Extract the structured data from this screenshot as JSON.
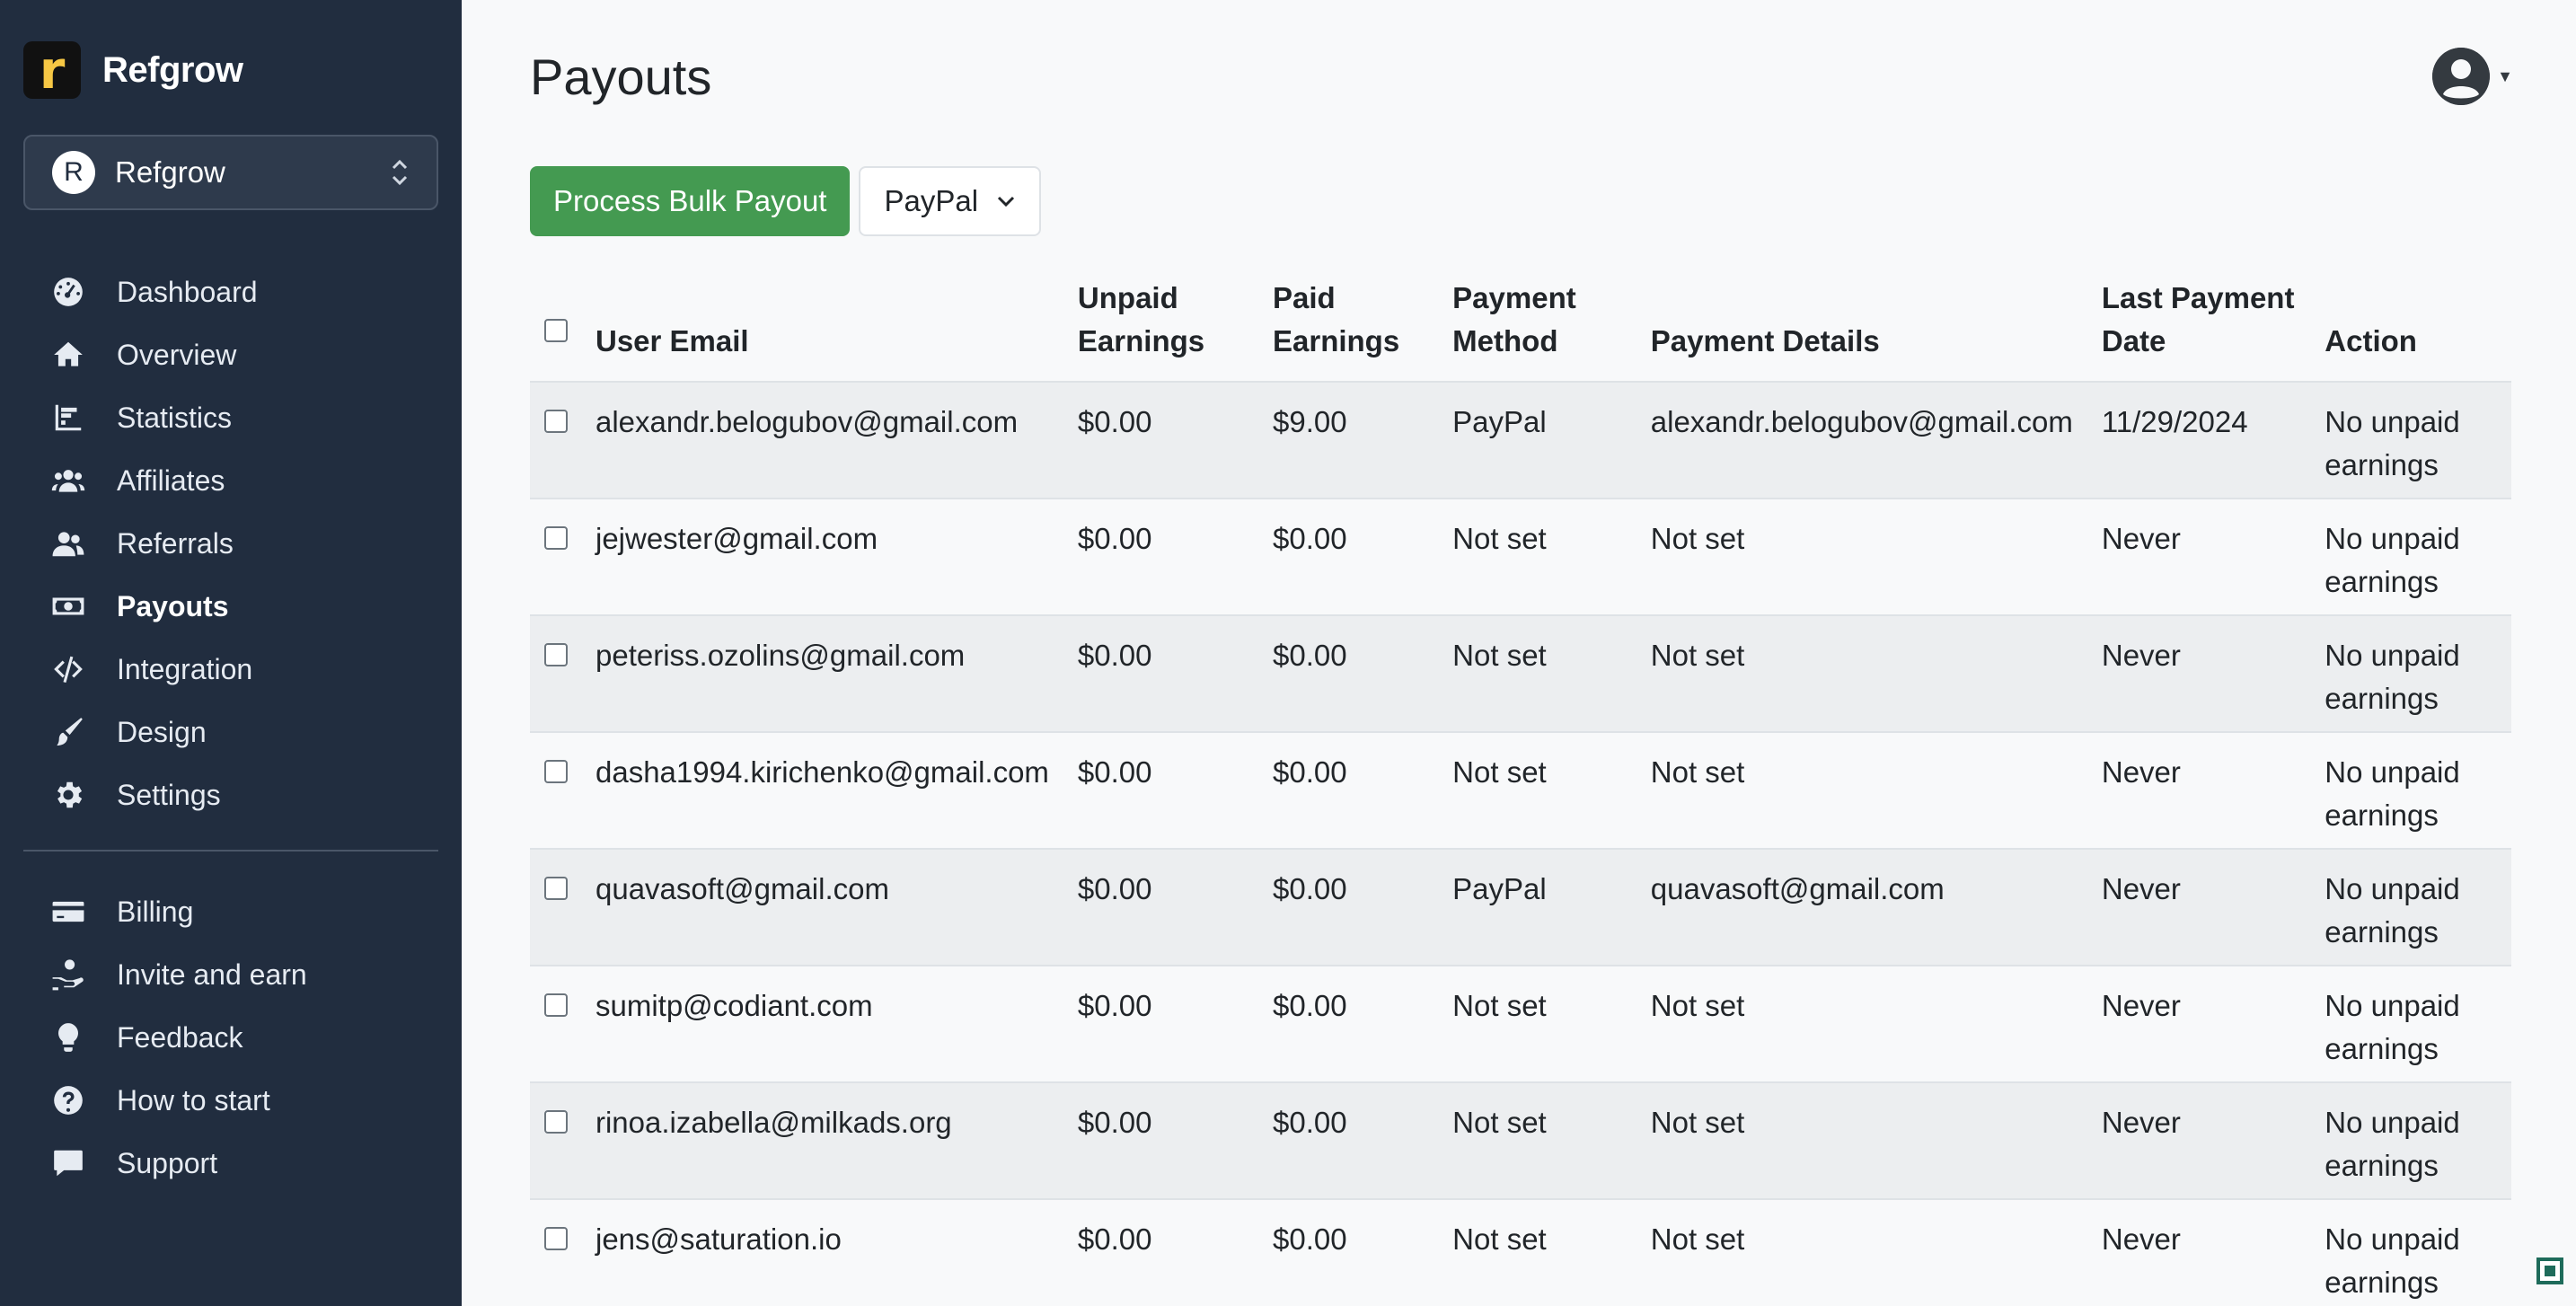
{
  "brand": {
    "logo_letter": "r",
    "name": "Refgrow"
  },
  "org": {
    "initial": "R",
    "name": "Refgrow"
  },
  "nav_primary": [
    {
      "label": "Dashboard",
      "icon": "gauge-icon"
    },
    {
      "label": "Overview",
      "icon": "home-icon"
    },
    {
      "label": "Statistics",
      "icon": "chart-icon"
    },
    {
      "label": "Affiliates",
      "icon": "users-icon"
    },
    {
      "label": "Referrals",
      "icon": "user-group-icon"
    },
    {
      "label": "Payouts",
      "icon": "money-icon",
      "active": true
    },
    {
      "label": "Integration",
      "icon": "code-icon"
    },
    {
      "label": "Design",
      "icon": "brush-icon"
    },
    {
      "label": "Settings",
      "icon": "gear-icon"
    }
  ],
  "nav_secondary": [
    {
      "label": "Billing",
      "icon": "credit-card-icon"
    },
    {
      "label": "Invite and earn",
      "icon": "hand-coin-icon"
    },
    {
      "label": "Feedback",
      "icon": "lightbulb-icon"
    },
    {
      "label": "How to start",
      "icon": "question-icon"
    },
    {
      "label": "Support",
      "icon": "chat-icon"
    }
  ],
  "page": {
    "title": "Payouts"
  },
  "toolbar": {
    "bulk_payout_label": "Process Bulk Payout",
    "method_value": "PayPal"
  },
  "table": {
    "headers": {
      "email": "User Email",
      "unpaid": "Unpaid Earnings",
      "paid": "Paid Earnings",
      "method": "Payment Method",
      "details": "Payment Details",
      "date": "Last Payment Date",
      "action": "Action"
    },
    "rows": [
      {
        "email": "alexandr.belogubov@gmail.com",
        "unpaid": "$0.00",
        "paid": "$9.00",
        "method": "PayPal",
        "details": "alexandr.belogubov@gmail.com",
        "date": "11/29/2024",
        "action": "No unpaid earnings"
      },
      {
        "email": "jejwester@gmail.com",
        "unpaid": "$0.00",
        "paid": "$0.00",
        "method": "Not set",
        "details": "Not set",
        "date": "Never",
        "action": "No unpaid earnings"
      },
      {
        "email": "peteriss.ozolins@gmail.com",
        "unpaid": "$0.00",
        "paid": "$0.00",
        "method": "Not set",
        "details": "Not set",
        "date": "Never",
        "action": "No unpaid earnings"
      },
      {
        "email": "dasha1994.kirichenko@gmail.com",
        "unpaid": "$0.00",
        "paid": "$0.00",
        "method": "Not set",
        "details": "Not set",
        "date": "Never",
        "action": "No unpaid earnings"
      },
      {
        "email": "quavasoft@gmail.com",
        "unpaid": "$0.00",
        "paid": "$0.00",
        "method": "PayPal",
        "details": "quavasoft@gmail.com",
        "date": "Never",
        "action": "No unpaid earnings"
      },
      {
        "email": "sumitp@codiant.com",
        "unpaid": "$0.00",
        "paid": "$0.00",
        "method": "Not set",
        "details": "Not set",
        "date": "Never",
        "action": "No unpaid earnings"
      },
      {
        "email": "rinoa.izabella@milkads.org",
        "unpaid": "$0.00",
        "paid": "$0.00",
        "method": "Not set",
        "details": "Not set",
        "date": "Never",
        "action": "No unpaid earnings"
      },
      {
        "email": "jens@saturation.io",
        "unpaid": "$0.00",
        "paid": "$0.00",
        "method": "Not set",
        "details": "Not set",
        "date": "Never",
        "action": "No unpaid earnings"
      }
    ]
  },
  "colors": {
    "sidebar_bg": "#212d3f",
    "primary_button": "#449a51",
    "page_bg": "#f8f9fa"
  }
}
